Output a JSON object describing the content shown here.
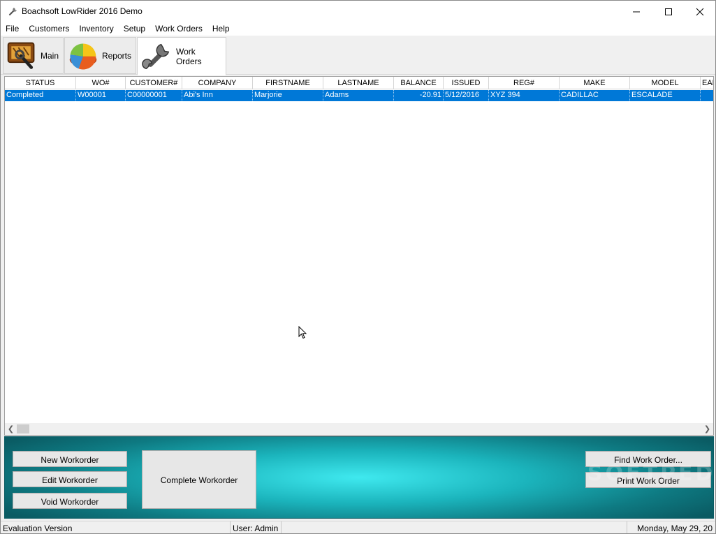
{
  "window": {
    "title": "Boachsoft LowRider 2016 Demo",
    "minimize_label": "minimize",
    "maximize_label": "maximize",
    "close_label": "close"
  },
  "menu": [
    "File",
    "Customers",
    "Inventory",
    "Setup",
    "Work Orders",
    "Help"
  ],
  "toolbar": {
    "tabs": [
      {
        "label": "Main",
        "icon": "main-app-icon",
        "active": false
      },
      {
        "label": "Reports",
        "icon": "pie-chart-icon",
        "active": false
      },
      {
        "label": "Work Orders",
        "icon": "wrench-icon",
        "active": true
      }
    ]
  },
  "grid": {
    "columns": [
      "STATUS",
      "WO#",
      "CUSTOMER#",
      "COMPANY",
      "FIRSTNAME",
      "LASTNAME",
      "BALANCE",
      "ISSUED",
      "REG#",
      "MAKE",
      "MODEL",
      "EAR"
    ],
    "rows": [
      [
        "Completed",
        "W00001",
        "C00000001",
        "Abi's Inn",
        "Marjorie",
        "Adams",
        "-20.91",
        "5/12/2016",
        "XYZ 394",
        "CADILLAC",
        "ESCALADE",
        ""
      ]
    ],
    "selected_row": 0
  },
  "actions": {
    "new_workorder": "New Workorder",
    "edit_workorder": "Edit Workorder",
    "void_workorder": "Void Workorder",
    "complete_workorder": "Complete Workorder",
    "find_work_order": "Find Work Order...",
    "print_work_order": "Print Work Order"
  },
  "watermark": "SOFTPEDIA",
  "status": {
    "edition": "Evaluation Version",
    "user": "User: Admin",
    "date": "Monday, May 29, 20"
  },
  "colors": {
    "selection": "#0078d7",
    "panel_accent": "#3fe9ef",
    "panel_dark": "#0a5b63"
  }
}
